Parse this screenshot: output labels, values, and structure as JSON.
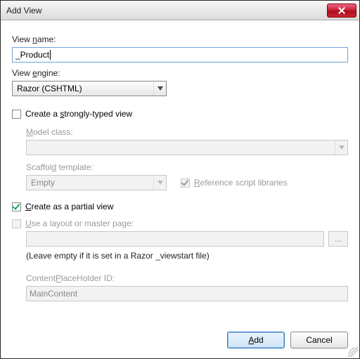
{
  "title": "Add View",
  "labels": {
    "viewName_pre": "View ",
    "viewName_u": "n",
    "viewName_post": "ame:",
    "viewEngine_pre": "View ",
    "viewEngine_u": "e",
    "viewEngine_post": "ngine:",
    "stronglyTyped_pre": "Create a ",
    "stronglyTyped_u": "s",
    "stronglyTyped_post": "trongly-typed view",
    "modelClass_u": "M",
    "modelClass_post": "odel class:",
    "scaffold_pre": "Scaffol",
    "scaffold_u": "d",
    "scaffold_post": " template:",
    "refScripts_u": "R",
    "refScripts_post": "eference script libraries",
    "partial_u": "C",
    "partial_post": "reate as a partial view",
    "layout_u": "U",
    "layout_post": "se a layout or master page:",
    "hint": "(Leave empty if it is set in a Razor _viewstart file)",
    "cph_pre": "Content",
    "cph_u": "P",
    "cph_post": "laceHolder ID:",
    "browse": "..."
  },
  "values": {
    "viewName": "_Product",
    "viewEngine": "Razor (CSHTML)",
    "modelClass": "",
    "scaffold": "Empty",
    "layoutPath": "",
    "cphId": "MainContent"
  },
  "checks": {
    "stronglyTyped": false,
    "refScripts": true,
    "partial": true,
    "useLayout": false
  },
  "buttons": {
    "add_u": "A",
    "add_post": "dd",
    "cancel": "Cancel"
  }
}
